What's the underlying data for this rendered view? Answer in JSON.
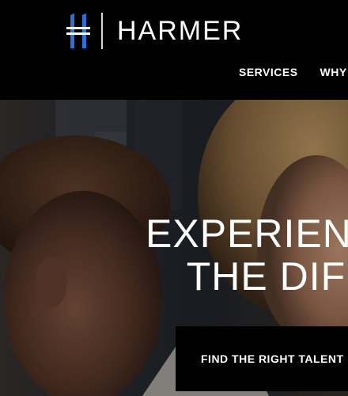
{
  "brand": {
    "name": "HARMER",
    "logo_icon": "harmer-h-logo-icon",
    "accent_color": "#2f6fd6"
  },
  "nav": {
    "items": [
      {
        "label": "SERVICES"
      },
      {
        "label": "WHY I"
      }
    ]
  },
  "hero": {
    "title_line1": "EXPERIEN",
    "title_line2": "THE DIF",
    "cta_label": "FIND THE RIGHT TALENT"
  }
}
